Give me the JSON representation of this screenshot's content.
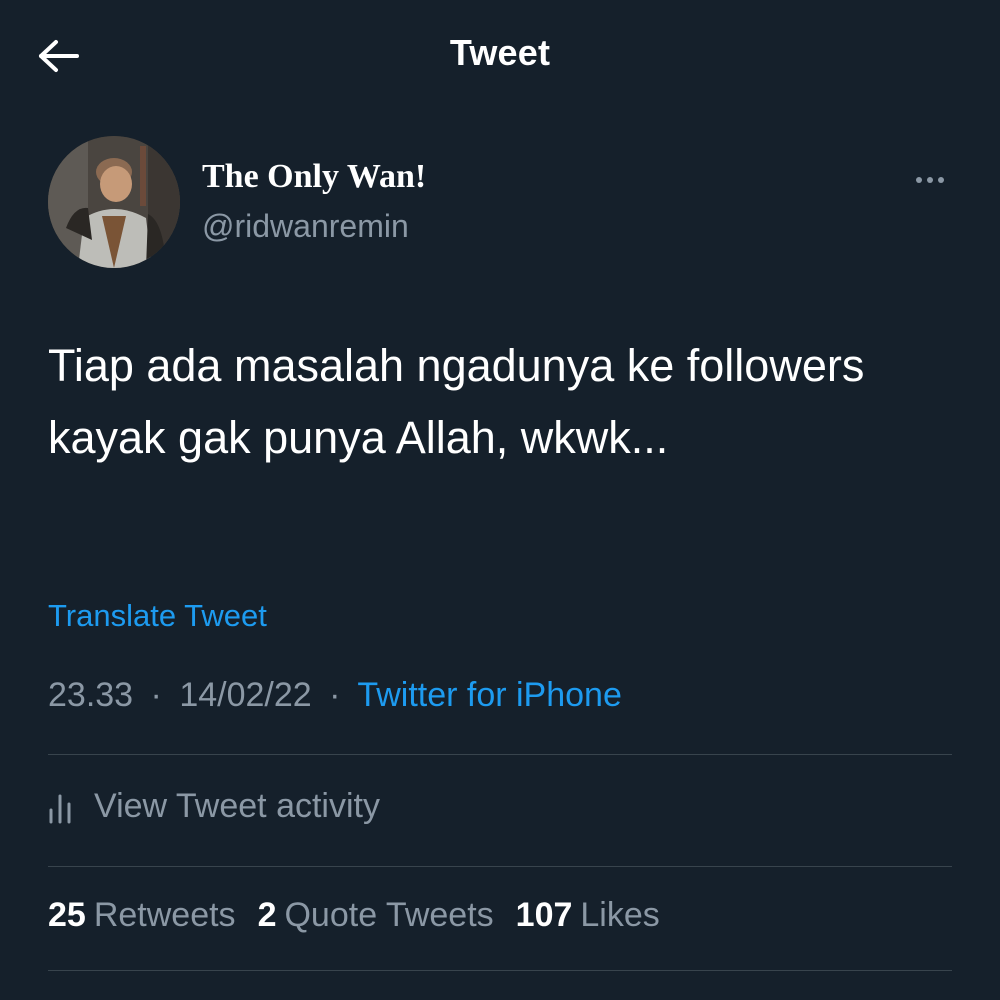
{
  "header": {
    "title": "Tweet",
    "back_icon": "arrow-left-icon"
  },
  "author": {
    "display_name": "The Only Wan!",
    "username": "@ridwanremin",
    "more_icon": "more-horizontal-icon"
  },
  "tweet": {
    "text": "Tiap ada masalah ngadunya ke followers kayak gak punya Allah, wkwk...",
    "translate_label": "Translate Tweet",
    "time": "23.33",
    "date": "14/02/22",
    "separator": "·",
    "source": "Twitter for iPhone"
  },
  "activity": {
    "label": "View Tweet activity",
    "icon": "analytics-icon"
  },
  "stats": [
    {
      "count": "25",
      "label": "Retweets"
    },
    {
      "count": "2",
      "label": "Quote Tweets"
    },
    {
      "count": "107",
      "label": "Likes"
    }
  ],
  "colors": {
    "background": "#15202b",
    "accent": "#1d9bf0",
    "secondary_text": "#8b98a5",
    "divider": "#38444d"
  }
}
